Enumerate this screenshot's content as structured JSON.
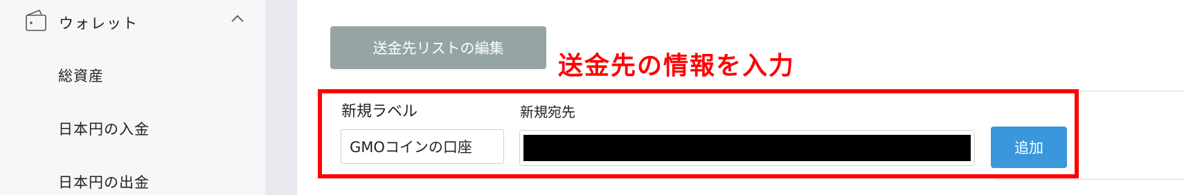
{
  "sidebar": {
    "wallet": {
      "label": "ウォレット",
      "icon": "wallet-icon",
      "toggle_icon": "chevron-up-icon"
    },
    "items": [
      {
        "label": "総資産"
      },
      {
        "label": "日本円の入金"
      },
      {
        "label": "日本円の出金"
      }
    ]
  },
  "main": {
    "edit_list_button": "送金先リストの編集",
    "annotation": "送金先の情報を入力",
    "form": {
      "label_header": "新規ラベル",
      "address_header": "新規宛先",
      "label_value": "GMOコインの口座",
      "address_value": "",
      "add_button": "追加"
    }
  },
  "colors": {
    "sidebar_bg": "#f7f7f9",
    "edit_button_bg": "#95a5a6",
    "add_button_bg": "#3a97db",
    "annotation": "#ff0000"
  }
}
